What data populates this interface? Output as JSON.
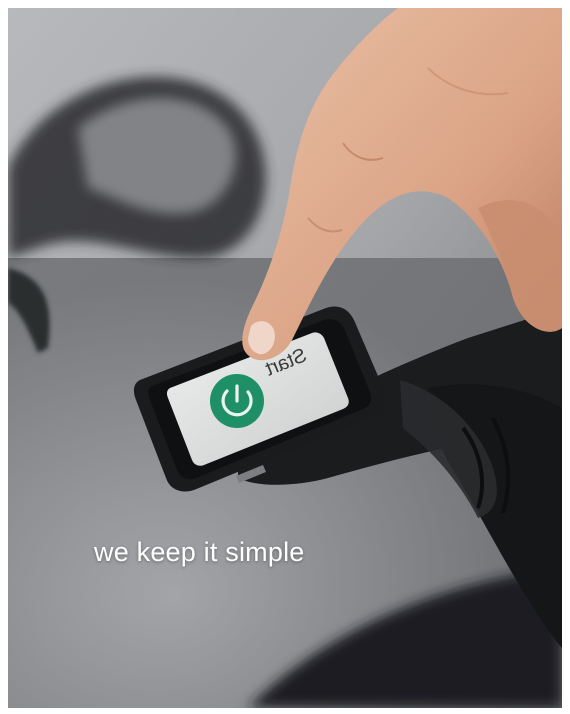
{
  "photo": {
    "description_icon": "photo-icon"
  },
  "device": {
    "screen_text": "Start",
    "icon": "power-icon",
    "accent": "#1e8f66"
  },
  "caption": {
    "text": "we keep it simple"
  }
}
